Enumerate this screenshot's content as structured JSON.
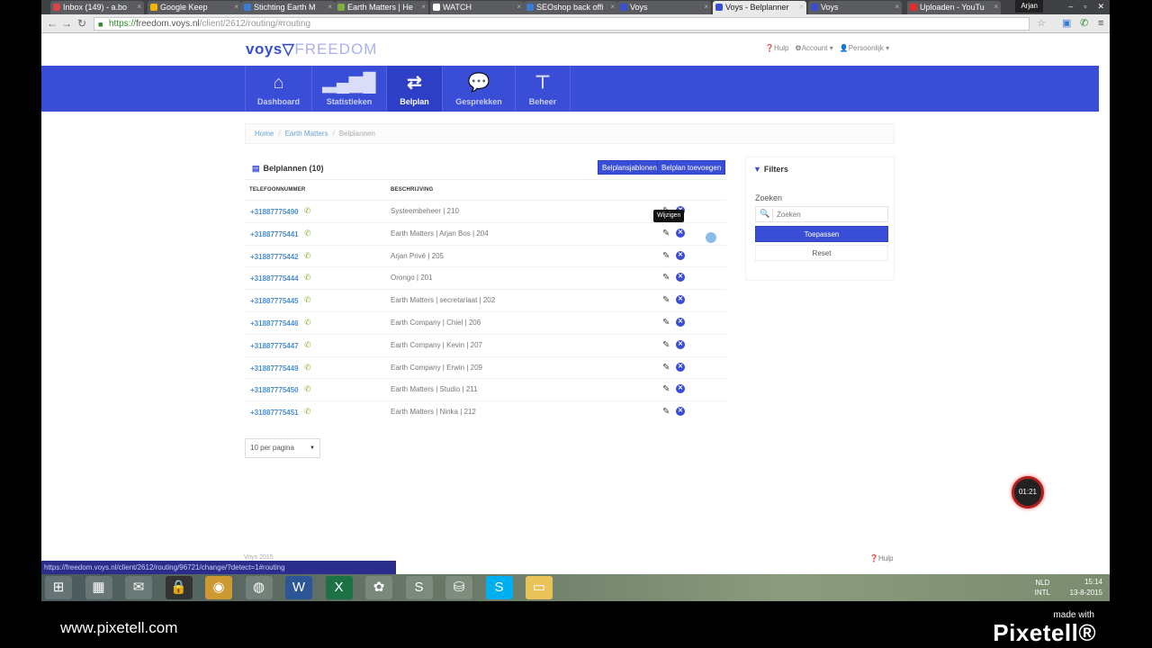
{
  "browser": {
    "tabs": [
      {
        "label": "Inbox (149) - a.bo",
        "color": "#d44"
      },
      {
        "label": "Google Keep",
        "color": "#f4b400"
      },
      {
        "label": "Stichting Earth M",
        "color": "#3a7bd5"
      },
      {
        "label": "Earth Matters | He",
        "color": "#7bb13c"
      },
      {
        "label": "WATCH",
        "color": "#fff"
      },
      {
        "label": "SEOshop back offi",
        "color": "#3a7bd5"
      },
      {
        "label": "Voys",
        "color": "#3a4dd6"
      },
      {
        "label": "Voys - Belplanner",
        "color": "#3a4dd6"
      },
      {
        "label": "Voys",
        "color": "#3a4dd6"
      },
      {
        "label": "Uploaden - YouTu",
        "color": "#e52d27"
      }
    ],
    "user": "Arjan",
    "url_scheme": "https://",
    "url_host": "freedom.voys.nl",
    "url_path": "/client/2612/routing/#routing"
  },
  "site": {
    "logo_main": "voys",
    "logo_sub": "FREEDOM",
    "top_links": {
      "help": "Hulp",
      "account": "Account",
      "personal": "Persoonlijk"
    },
    "nav": [
      {
        "label": "Dashboard",
        "icon": "home-icon"
      },
      {
        "label": "Statistieken",
        "icon": "bar-chart-icon"
      },
      {
        "label": "Belplan",
        "icon": "retweet-icon"
      },
      {
        "label": "Gesprekken",
        "icon": "chat-bubbles-icon"
      },
      {
        "label": "Beheer",
        "icon": "sitemap-icon"
      }
    ],
    "breadcrumb": [
      "Home",
      "Earth Matters",
      "Belplannen"
    ]
  },
  "panel": {
    "title": "Belplannen (10)",
    "btn_templates": "Belplansjablonen",
    "btn_add": "Belplan toevoegen",
    "col_phone": "TELEFOONNUMMER",
    "col_desc": "BESCHRIJVING",
    "rows": [
      {
        "phone": "+31887775490",
        "desc": "Systeembeheer | 210"
      },
      {
        "phone": "+31887775441",
        "desc": "Earth Matters | Arjan Bos | 204"
      },
      {
        "phone": "+31887775442",
        "desc": "Arjan Privé | 205"
      },
      {
        "phone": "+31887775444",
        "desc": "Orongo | 201"
      },
      {
        "phone": "+31887775445",
        "desc": "Earth Matters | secretariaat | 202"
      },
      {
        "phone": "+31887775446",
        "desc": "Earth Company | Chiel | 206"
      },
      {
        "phone": "+31887775447",
        "desc": "Earth Company | Kevin | 207"
      },
      {
        "phone": "+31887775449",
        "desc": "Earth Company | Erwin | 209"
      },
      {
        "phone": "+31887775450",
        "desc": "Earth Matters | Studio | 211"
      },
      {
        "phone": "+31887775451",
        "desc": "Earth Matters | Ninka | 212"
      }
    ],
    "tooltip": "Wijzigen",
    "per_page": "10 per pagina"
  },
  "filters": {
    "title": "Filters",
    "search_label": "Zoeken",
    "search_placeholder": "Zoeken",
    "apply": "Toepassen",
    "reset": "Reset"
  },
  "footer": {
    "copyright": "Voys 2015",
    "help": "Hulp",
    "status_url": "https://freedom.voys.nl/client/2612/routing/96721/change/?detect=1#routing"
  },
  "timer": "01:21",
  "taskbar": {
    "lang": "NLD",
    "lang2": "INTL",
    "time": "15:14",
    "date": "13-8-2015",
    "apps": [
      "windows-start-icon",
      "calculator-icon",
      "thunderbird-icon",
      "keepass-icon",
      "chrome-icon",
      "firefox-icon",
      "word-icon",
      "excel-icon",
      "picasa-icon",
      "vpn-icon",
      "paint-bucket-icon",
      "skype-icon",
      "folder-icon"
    ]
  },
  "branding": {
    "url": "www.pixetell.com",
    "made_with": "made with",
    "logo": "Pixetell®"
  }
}
